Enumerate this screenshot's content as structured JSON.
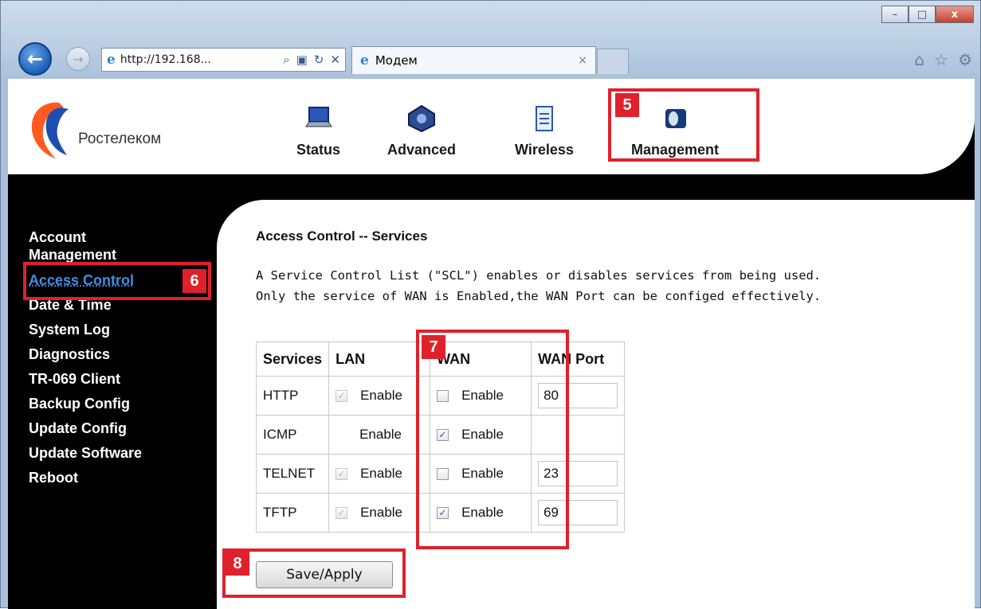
{
  "browser": {
    "address": "http://192.168...",
    "tab_title": "Модем",
    "tab_close": "×",
    "minimize": "–",
    "maximize": "□",
    "close": "x"
  },
  "brand": {
    "name": "Ростелеком"
  },
  "nav": [
    {
      "label": "Status"
    },
    {
      "label": "Advanced"
    },
    {
      "label": "Wireless"
    },
    {
      "label": "Management"
    }
  ],
  "sidebar": {
    "items": [
      {
        "label": "Account Management"
      },
      {
        "label": "Access Control"
      },
      {
        "label": "Date & Time"
      },
      {
        "label": "System Log"
      },
      {
        "label": "Diagnostics"
      },
      {
        "label": "TR-069 Client"
      },
      {
        "label": "Backup Config"
      },
      {
        "label": "Update Config"
      },
      {
        "label": "Update Software"
      },
      {
        "label": "Reboot"
      }
    ]
  },
  "page": {
    "title": "Access Control -- Services",
    "desc_line1": "A Service Control List (\"SCL\") enables or disables services from being used.",
    "desc_line2": "Only the service of WAN is Enabled,the WAN Port can be configed effectively."
  },
  "table": {
    "headers": {
      "services": "Services",
      "lan": "LAN",
      "wan": "WAN",
      "wan_port": "WAN Port"
    },
    "enable_label": "Enable",
    "rows": [
      {
        "service": "HTTP",
        "lan_checked": true,
        "lan_disabled": true,
        "wan_checked": false,
        "port": "80"
      },
      {
        "service": "ICMP",
        "lan_checked": false,
        "lan_disabled": true,
        "wan_checked": true,
        "port": ""
      },
      {
        "service": "TELNET",
        "lan_checked": true,
        "lan_disabled": true,
        "wan_checked": false,
        "port": "23"
      },
      {
        "service": "TFTP",
        "lan_checked": true,
        "lan_disabled": true,
        "wan_checked": true,
        "port": "69"
      }
    ]
  },
  "actions": {
    "save_label": "Save/Apply"
  },
  "annotations": {
    "n5": "5",
    "n6": "6",
    "n7": "7",
    "n8": "8"
  },
  "colors": {
    "annotation": "#e0212c",
    "active_menu": "#3f8ee8",
    "sidebar_bg": "#000000"
  }
}
